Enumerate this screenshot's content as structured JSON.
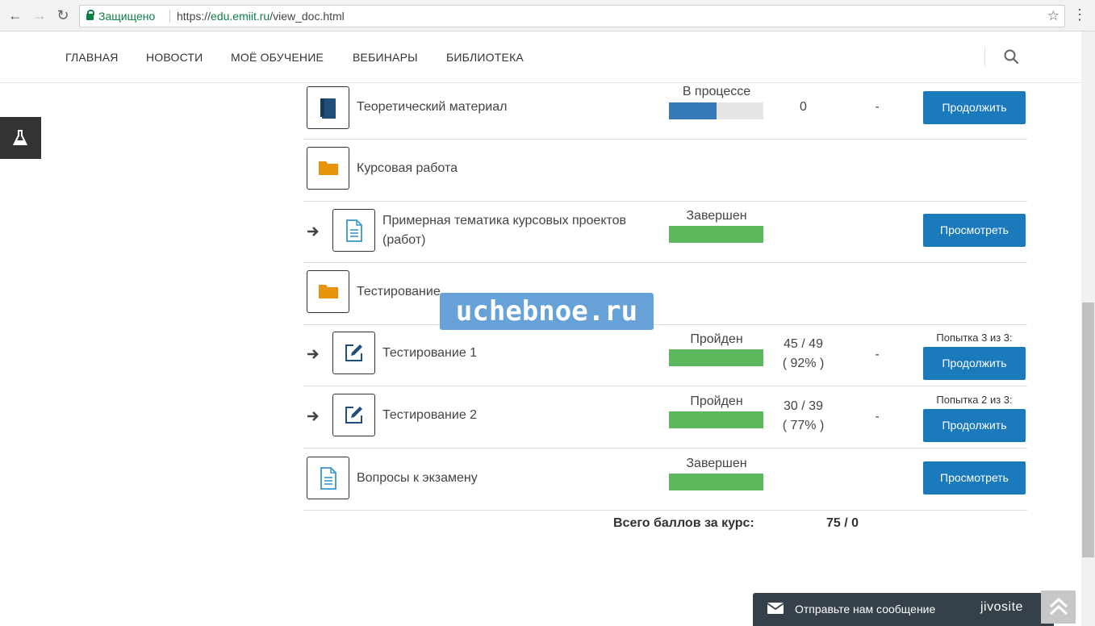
{
  "browser": {
    "secure_label": "Защищено",
    "url_scheme": "https://",
    "url_host": "edu.emiit.ru",
    "url_path": "/view_doc.html"
  },
  "nav": {
    "items": [
      "ГЛАВНАЯ",
      "НОВОСТИ",
      "МОЁ ОБУЧЕНИЕ",
      "ВЕБИНАРЫ",
      "БИБЛИОТЕКА"
    ]
  },
  "rows": [
    {
      "title": "Теоретический материал",
      "icon": "book-icon",
      "status": "В процессе",
      "progress": 0.5,
      "bar_color": "#337ab7",
      "score": "0",
      "dash": "-",
      "button": "Продолжить"
    },
    {
      "title": "Курсовая работа",
      "icon": "folder-icon"
    },
    {
      "title_line1": "Примерная тематика курсовых проектов",
      "title_line2": "(работ)",
      "icon": "document-icon",
      "status": "Завершен",
      "progress": 1.0,
      "bar_color": "#5cb85c",
      "button": "Просмотреть"
    },
    {
      "title": "Тестирование",
      "icon": "folder-icon"
    },
    {
      "title": "Тестирование 1",
      "icon": "edit-icon",
      "status": "Пройден",
      "progress": 1.0,
      "bar_color": "#5cb85c",
      "score_line1": "45 / 49",
      "score_line2": "( 92% )",
      "dash": "-",
      "attempt": "Попытка 3 из 3:",
      "button": "Продолжить"
    },
    {
      "title": "Тестирование 2",
      "icon": "edit-icon",
      "status": "Пройден",
      "progress": 1.0,
      "bar_color": "#5cb85c",
      "score_line1": "30 / 39",
      "score_line2": "( 77% )",
      "dash": "-",
      "attempt": "Попытка 2 из 3:",
      "button": "Продолжить"
    },
    {
      "title": "Вопросы к экзамену",
      "icon": "document-icon",
      "status": "Завершен",
      "progress": 1.0,
      "bar_color": "#5cb85c",
      "button": "Просмотреть"
    }
  ],
  "total": {
    "label": "Всего баллов за курс:",
    "value": "75 / 0"
  },
  "watermark": "uchebnoe.ru",
  "chat": {
    "text": "Отправьте нам сообщение",
    "brand": "jivosite"
  },
  "colors": {
    "accent_button": "#1a7abb",
    "progress_in_process": "#337ab7",
    "progress_done": "#5cb85c"
  }
}
